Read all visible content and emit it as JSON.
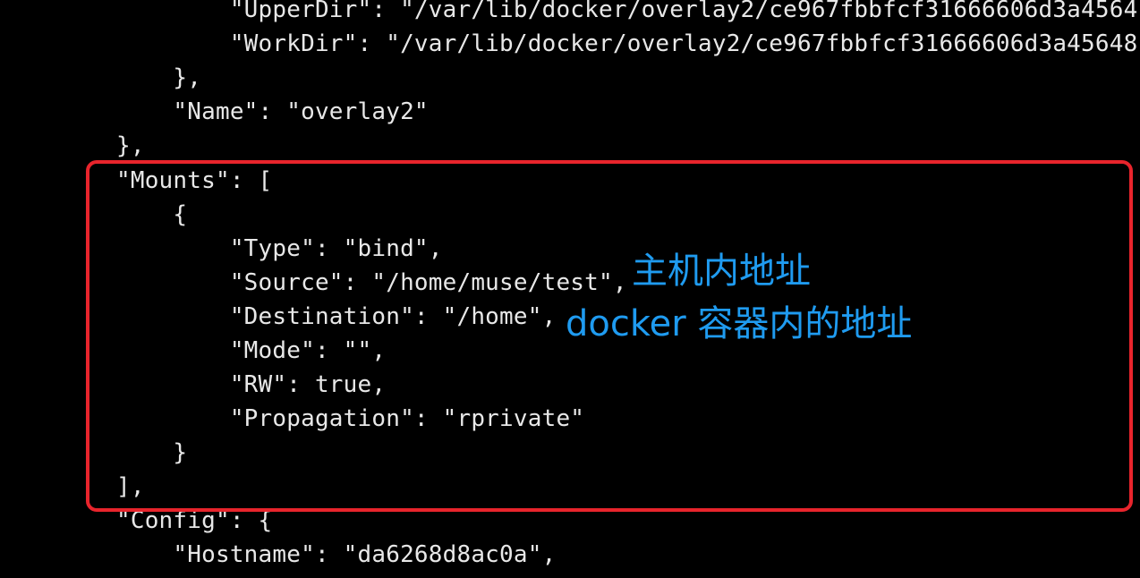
{
  "terminal": {
    "lines": [
      "        \"UpperDir\": \"/var/lib/docker/overlay2/ce967fbbfcf31666606d3a4564",
      "        \"WorkDir\": \"/var/lib/docker/overlay2/ce967fbbfcf31666606d3a45648",
      "    },",
      "    \"Name\": \"overlay2\"",
      "},",
      "\"Mounts\": [",
      "    {",
      "        \"Type\": \"bind\",",
      "        \"Source\": \"/home/muse/test\",",
      "        \"Destination\": \"/home\",",
      "        \"Mode\": \"\",",
      "        \"RW\": true,",
      "        \"Propagation\": \"rprivate\"",
      "    }",
      "],",
      "\"Config\": {",
      "    \"Hostname\": \"da6268d8ac0a\","
    ]
  },
  "annotations": {
    "host_address": "主机内地址",
    "container_address": "docker 容器内的地址"
  },
  "colors": {
    "background": "#000000",
    "text": "#e8e8e8",
    "highlight_border": "#e8242c",
    "annotation": "#1f9bf0"
  }
}
